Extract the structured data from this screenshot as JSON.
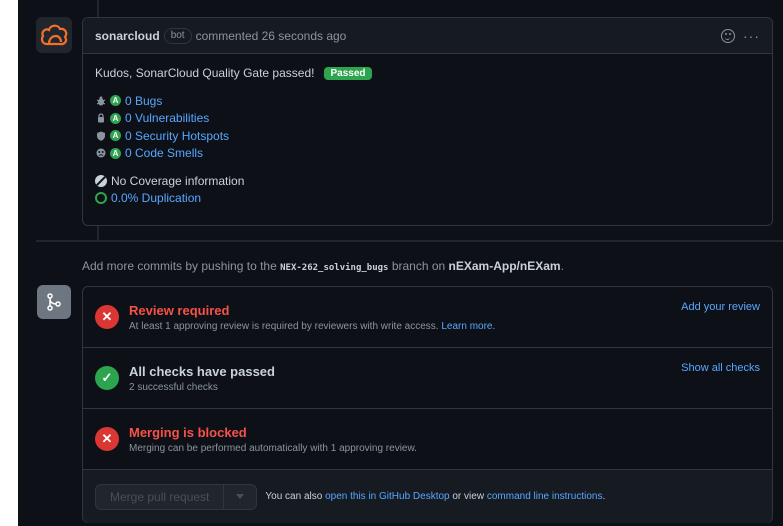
{
  "comment": {
    "author": "sonarcloud",
    "bot_badge": "bot",
    "action_text": "commented 26 seconds ago",
    "more_icon": "kebab-horizontal-icon",
    "emoji_icon": "smiley-icon",
    "kudos_text": "Kudos, SonarCloud Quality Gate passed!",
    "status_badge": "Passed",
    "metrics": [
      {
        "icon": "bug-icon",
        "grade": "A",
        "label": "0 Bugs"
      },
      {
        "icon": "lock-icon",
        "grade": "A",
        "label": "0 Vulnerabilities"
      },
      {
        "icon": "shield-icon",
        "grade": "A",
        "label": "0 Security Hotspots"
      },
      {
        "icon": "code-smell-icon",
        "grade": "A",
        "label": "0 Code Smells"
      }
    ],
    "coverage_text": "No Coverage information",
    "duplication_text": "0.0% Duplication"
  },
  "push_hint": {
    "prefix": "Add more commits by pushing to the",
    "branch": "NEX-262_solving_bugs",
    "middle": "branch on",
    "repo": "nEXam-App/nEXam",
    "suffix": "."
  },
  "merge": {
    "rows": [
      {
        "status": "fail",
        "title": "Review required",
        "subtitle": "At least 1 approving review is required by reviewers with write access.",
        "subtitle_link": "Learn more.",
        "action": "Add your review"
      },
      {
        "status": "ok",
        "title": "All checks have passed",
        "subtitle": "2 successful checks",
        "action": "Show all checks"
      },
      {
        "status": "fail",
        "title": "Merging is blocked",
        "subtitle": "Merging can be performed automatically with 1 approving review."
      }
    ],
    "button_label": "Merge pull request",
    "footer_prefix": "You can also",
    "footer_link1": "open this in GitHub Desktop",
    "footer_middle": "or view",
    "footer_link2": "command line instructions",
    "footer_suffix": "."
  },
  "colors": {
    "background": "#0d1117",
    "border": "#30363d",
    "link": "#58a6ff",
    "success": "#2da44e",
    "danger": "#da3633",
    "sonar_orange": "#f3702a"
  }
}
